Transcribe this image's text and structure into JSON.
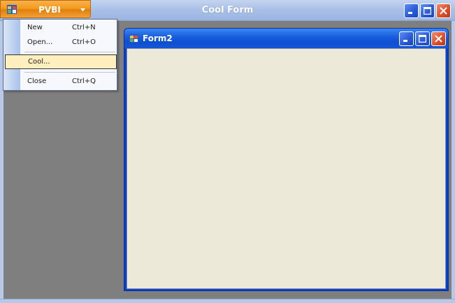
{
  "window": {
    "title": "Cool Form"
  },
  "app_button": {
    "label": "PVBI",
    "icon": "app-icon",
    "arrow_icon": "chevron-down-icon"
  },
  "menu": {
    "items": [
      {
        "label": "New",
        "shortcut": "Ctrl+N",
        "highlighted": false
      },
      {
        "label": "Open...",
        "shortcut": "Ctrl+O",
        "highlighted": false
      },
      {
        "label": "Cool...",
        "shortcut": "",
        "highlighted": true
      },
      {
        "label": "Close",
        "shortcut": "Ctrl+Q",
        "highlighted": false
      }
    ]
  },
  "child_window": {
    "title": "Form2",
    "icon": "form-icon"
  },
  "colors": {
    "accent": "#f39a1e",
    "titlebar": "#1a5fe0",
    "client": "#ece9d8",
    "highlight": "#ffefbe"
  }
}
